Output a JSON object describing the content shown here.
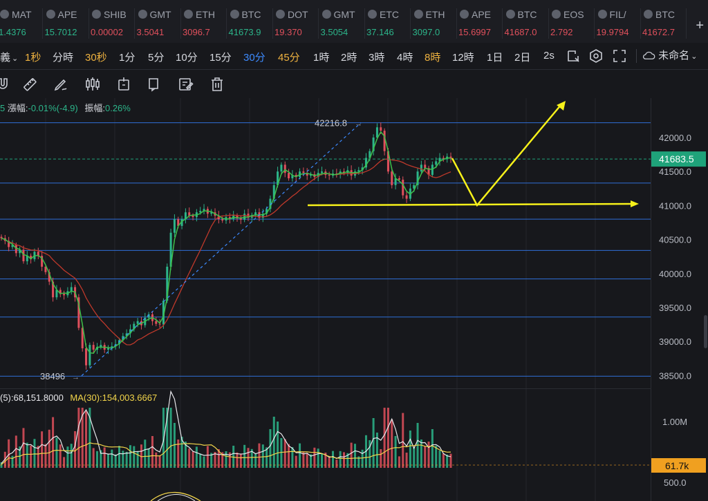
{
  "ticker": {
    "items": [
      {
        "symbol": "MAT",
        "price": "1.4376",
        "dir": "up"
      },
      {
        "symbol": "APE",
        "price": "15.7012",
        "dir": "up"
      },
      {
        "symbol": "SHIB",
        "price": "0.00002",
        "dir": "down"
      },
      {
        "symbol": "GMT",
        "price": "3.5041",
        "dir": "down"
      },
      {
        "symbol": "ETH",
        "price": "3096.7",
        "dir": "down"
      },
      {
        "symbol": "BTC",
        "price": "41673.9",
        "dir": "up"
      },
      {
        "symbol": "DOT",
        "price": "19.370",
        "dir": "down"
      },
      {
        "symbol": "GMT",
        "price": "3.5054",
        "dir": "up"
      },
      {
        "symbol": "ETC",
        "price": "37.146",
        "dir": "up"
      },
      {
        "symbol": "ETH",
        "price": "3097.0",
        "dir": "up"
      },
      {
        "symbol": "APE",
        "price": "15.6997",
        "dir": "down"
      },
      {
        "symbol": "BTC",
        "price": "41687.0",
        "dir": "down"
      },
      {
        "symbol": "EOS",
        "price": "2.792",
        "dir": "down"
      },
      {
        "symbol": "FIL/",
        "price": "19.9794",
        "dir": "down"
      },
      {
        "symbol": "BTC",
        "price": "41672.7",
        "dir": "down"
      }
    ],
    "more": "+"
  },
  "toolbar": {
    "chart_type_label": "義",
    "selected_tf": "1秒",
    "timeframes": [
      {
        "label": "分時",
        "color": "white"
      },
      {
        "label": "30秒",
        "color": "orange"
      },
      {
        "label": "1分",
        "color": "white"
      },
      {
        "label": "5分",
        "color": "white"
      },
      {
        "label": "10分",
        "color": "white"
      },
      {
        "label": "15分",
        "color": "white"
      },
      {
        "label": "30分",
        "color": "blue"
      },
      {
        "label": "45分",
        "color": "orange"
      },
      {
        "label": "1時",
        "color": "white"
      },
      {
        "label": "2時",
        "color": "white"
      },
      {
        "label": "3時",
        "color": "white"
      },
      {
        "label": "4時",
        "color": "white"
      },
      {
        "label": "8時",
        "color": "orange"
      },
      {
        "label": "12時",
        "color": "white"
      },
      {
        "label": "1日",
        "color": "white"
      },
      {
        "label": "2日",
        "color": "white"
      },
      {
        "label": "2s",
        "color": "white"
      }
    ],
    "layout_name": "未命名"
  },
  "drawing_tools": [
    "magnet-icon",
    "ruler-icon",
    "pen-icon",
    "candles-icon",
    "crop-icon",
    "copy-icon",
    "note-icon",
    "trash-icon"
  ],
  "ohlc": {
    "prefix": "5",
    "change_label": "漲幅:",
    "change_value": "-0.01%(-4.9)",
    "amplitude_label": "振幅:",
    "amplitude_value": "0.26%"
  },
  "volume": {
    "ma5_text": "(5):68,151.8000",
    "ma30_text": "MA(30):154,003.6667",
    "axis_labels": [
      "1.00M",
      "500.0"
    ],
    "current_label": "61.7k"
  },
  "colors": {
    "up": "#2cb58a",
    "down": "#e0505c",
    "accent_blue": "#3d8bff",
    "accent_orange": "#f0b340",
    "annotation_yellow": "#f7f11a",
    "price_tag": "#1fa37a",
    "volume_tag": "#f0a020"
  },
  "chart_data": {
    "type": "candlestick",
    "price_axis": {
      "ticks": [
        42000,
        41500,
        41000,
        40500,
        40000,
        39500,
        39000,
        38500
      ],
      "tick_labels": [
        "42000.0",
        "41500.0",
        "41000.0",
        "40500.0",
        "40000.0",
        "39500.0",
        "39000.0",
        "38500.0"
      ]
    },
    "current_price": 41683.5,
    "current_price_label": "41683.5",
    "high_marker": {
      "label": "42216.8",
      "value": 42216.8
    },
    "low_marker": {
      "label": "38496",
      "value": 38496
    },
    "horizontal_levels": [
      42216.8,
      41330,
      40800,
      40340,
      39920,
      39360,
      38490
    ],
    "closes": [
      40520,
      40480,
      40390,
      40420,
      40300,
      40350,
      40180,
      40260,
      40210,
      40320,
      40260,
      40100,
      40020,
      39880,
      39650,
      39760,
      39700,
      39680,
      39740,
      39800,
      39650,
      39200,
      38900,
      38650,
      38950,
      38880,
      38920,
      38950,
      38880,
      38900,
      38930,
      38960,
      39020,
      39080,
      39120,
      39180,
      39260,
      39300,
      39240,
      39350,
      39400,
      39300,
      39260,
      39250,
      39600,
      40100,
      40600,
      40800,
      40700,
      40800,
      40900,
      40850,
      40830,
      40900,
      40920,
      40950,
      40880,
      40900,
      40850,
      40800,
      40780,
      40830,
      40800,
      40850,
      40810,
      40790,
      40880,
      40820,
      40860,
      40900,
      40820,
      40880,
      40950,
      41100,
      41300,
      41500,
      41600,
      41480,
      41400,
      41450,
      41420,
      41500,
      41480,
      41440,
      41460,
      41420,
      41480,
      41500,
      41450,
      41440,
      41470,
      41460,
      41500,
      41480,
      41520,
      41440,
      41500,
      41520,
      41560,
      41700,
      41800,
      42000,
      42150,
      42100,
      41800,
      41500,
      41300,
      41400,
      41380,
      41150,
      41100,
      41250,
      41300,
      41500,
      41600,
      41550,
      41450,
      41600,
      41650,
      41700,
      41680,
      41720,
      41690
    ]
  }
}
